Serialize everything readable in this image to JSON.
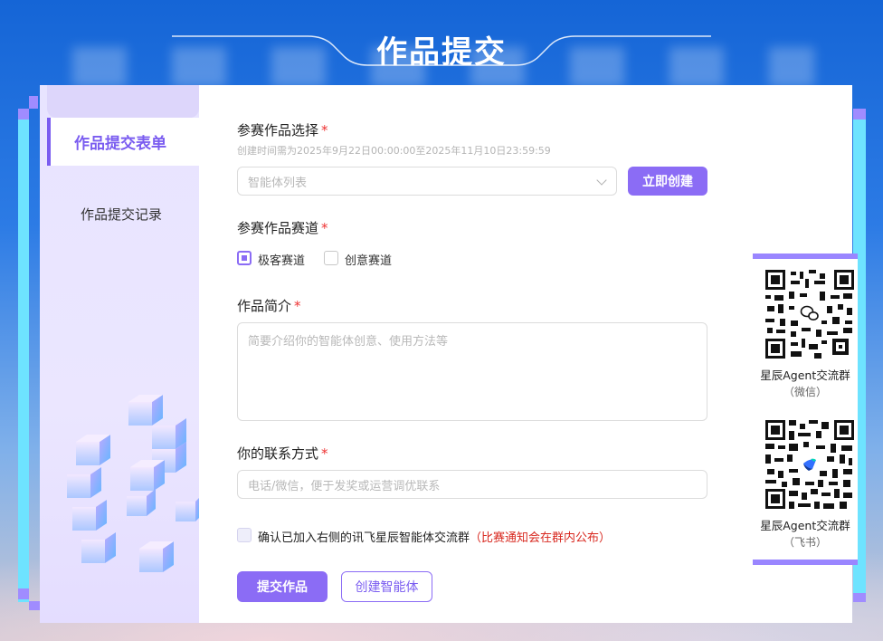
{
  "header": {
    "title": "作品提交"
  },
  "sidebar": {
    "items": [
      {
        "label": "作品提交表单",
        "active": true
      },
      {
        "label": "作品提交记录",
        "active": false
      }
    ]
  },
  "form": {
    "work_select": {
      "label": "参赛作品选择",
      "required_mark": "*",
      "hint": "创建时间需为2025年9月22日00:00:00至2025年11月10日23:59:59",
      "placeholder": "智能体列表",
      "create_button": "立即创建"
    },
    "track": {
      "label": "参赛作品赛道",
      "required_mark": "*",
      "options": [
        {
          "label": "极客赛道",
          "checked": true
        },
        {
          "label": "创意赛道",
          "checked": false
        }
      ]
    },
    "intro": {
      "label": "作品简介",
      "required_mark": "*",
      "placeholder": "简要介绍你的智能体创意、使用方法等"
    },
    "contact": {
      "label": "你的联系方式",
      "required_mark": "*",
      "placeholder": "电话/微信，便于发奖或运营调优联系"
    },
    "confirm": {
      "text": "确认已加入右侧的讯飞星辰智能体交流群",
      "note": "（比赛通知会在群内公布）",
      "checked": false
    },
    "submit_button": "提交作品",
    "create_agent_button": "创建智能体"
  },
  "qr_panel": {
    "groups": [
      {
        "name": "星辰Agent交流群",
        "platform": "（微信）",
        "icon": "wechat-icon"
      },
      {
        "name": "星辰Agent交流群",
        "platform": "（飞书）",
        "icon": "feishu-icon"
      }
    ]
  },
  "colors": {
    "accent": "#8b6cf5",
    "accent_dark": "#7a5cf0",
    "required": "#e33333",
    "note": "#d8281f",
    "frame_cyan": "#6ee3ff",
    "background_blue": "#1565d6"
  }
}
